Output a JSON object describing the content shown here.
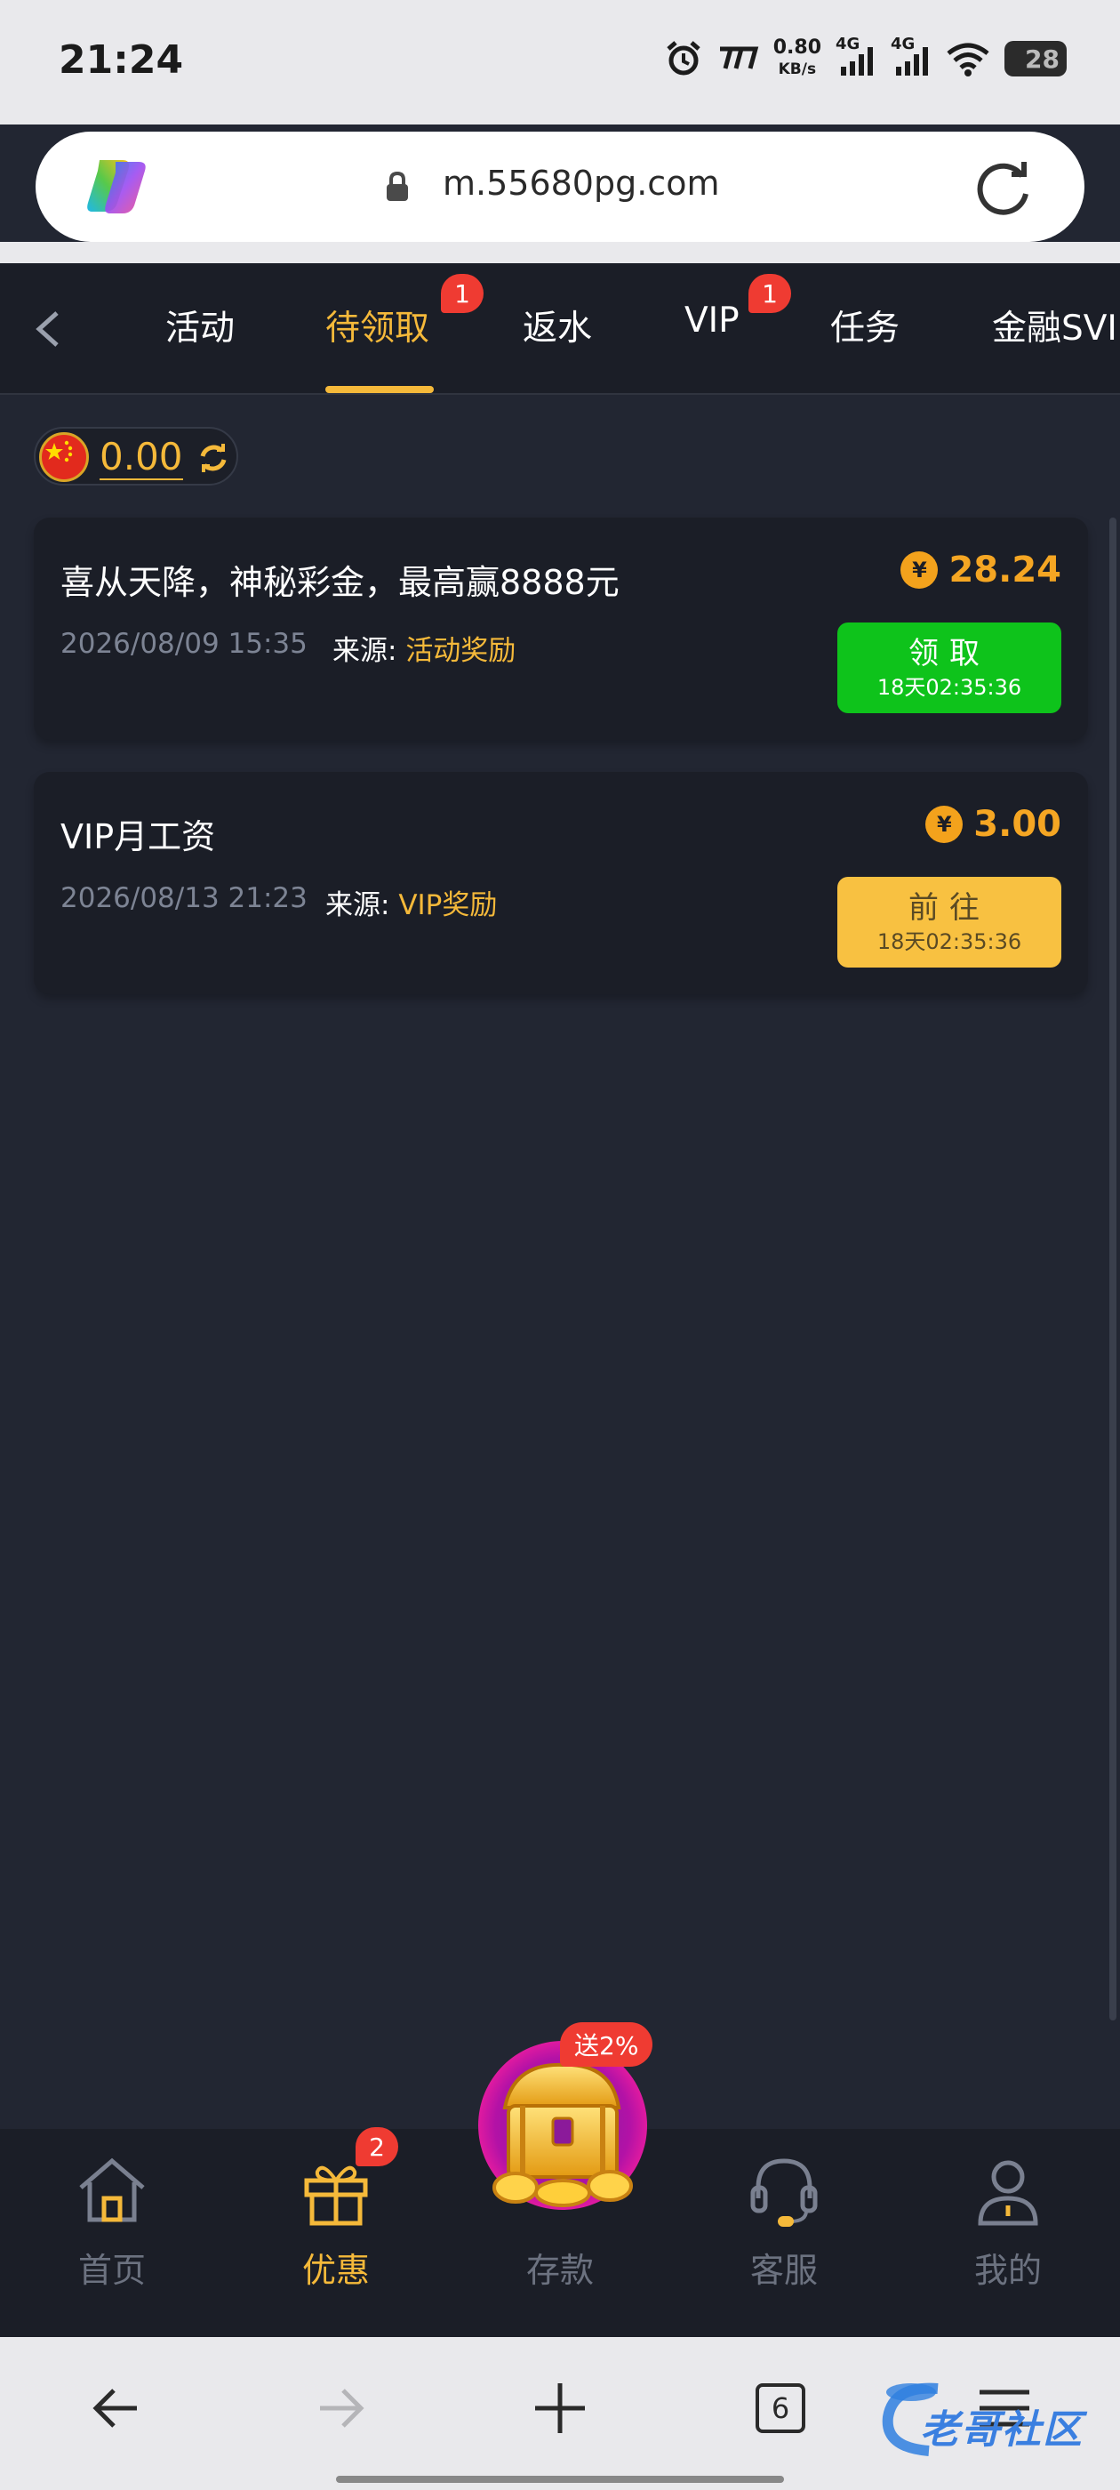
{
  "status_bar": {
    "time": "21:24",
    "speed_value": "0.80",
    "speed_unit": "KB/s",
    "net1": "4G",
    "net2": "4G",
    "battery": "28",
    "icons": [
      "alarm-icon",
      "app-icon",
      "signal-icon",
      "signal-icon",
      "wifi-icon",
      "battery-icon"
    ]
  },
  "browser": {
    "url": "m.55680pg.com",
    "tabs_count": "6"
  },
  "tabs": [
    {
      "label": "活动",
      "active": false
    },
    {
      "label": "待领取",
      "active": true,
      "badge": "1"
    },
    {
      "label": "返水",
      "active": false
    },
    {
      "label": "VIP",
      "active": false,
      "badge": "1"
    },
    {
      "label": "任务",
      "active": false
    },
    {
      "label": "金融SVI",
      "active": false
    }
  ],
  "balance": {
    "value": "0.00"
  },
  "rewards": [
    {
      "title": "喜从天降，神秘彩金，最高赢8888元",
      "date": "2026/08/09 15:35",
      "source_label": "来源:",
      "source": "活动奖励",
      "coin_symbol": "¥",
      "amount": "28.24",
      "button_label": "领取",
      "countdown": "18天02:35:36",
      "button_color": "#0ec31b"
    },
    {
      "title": "VIP月工资",
      "date": "2026/08/13 21:23",
      "source_label": "来源:",
      "source": "VIP奖励",
      "coin_symbol": "¥",
      "amount": "3.00",
      "button_label": "前往",
      "countdown": "18天02:35:36",
      "button_color": "#f8c141"
    }
  ],
  "bottom_nav": {
    "items": [
      {
        "label": "首页",
        "icon": "home-icon",
        "active": false
      },
      {
        "label": "优惠",
        "icon": "gift-icon",
        "active": true,
        "badge": "2"
      },
      {
        "label": "存款",
        "icon": "treasure-chest-icon",
        "active": false
      },
      {
        "label": "客服",
        "icon": "headset-icon",
        "active": false
      },
      {
        "label": "我的",
        "icon": "profile-icon",
        "active": false
      }
    ],
    "deposit_promo": "送2%"
  },
  "watermark": "老哥社区",
  "colors": {
    "accent": "#f5b93a",
    "background": "#222632",
    "card": "#1b1e27",
    "badge": "#ef3b32",
    "claim_button": "#0ec31b",
    "goto_button": "#f8c141"
  }
}
